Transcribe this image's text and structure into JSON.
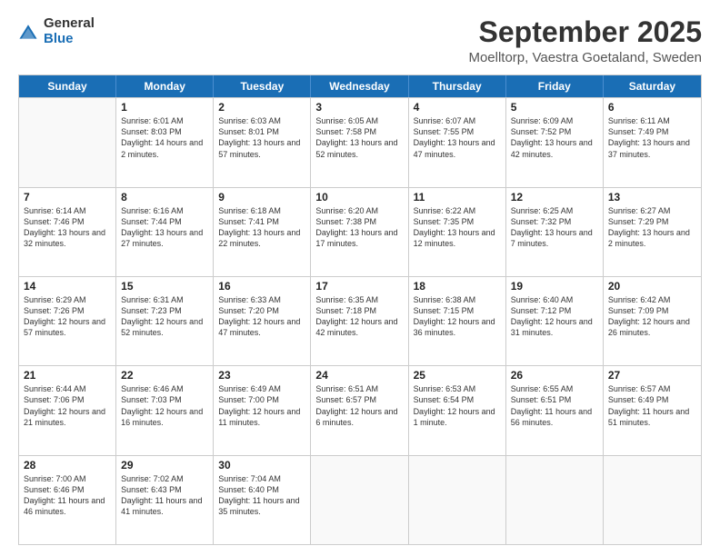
{
  "header": {
    "logo_general": "General",
    "logo_blue": "Blue",
    "month_title": "September 2025",
    "location": "Moelltorp, Vaestra Goetaland, Sweden"
  },
  "calendar": {
    "days_of_week": [
      "Sunday",
      "Monday",
      "Tuesday",
      "Wednesday",
      "Thursday",
      "Friday",
      "Saturday"
    ],
    "rows": [
      [
        {
          "day": "",
          "sunrise": "",
          "sunset": "",
          "daylight": ""
        },
        {
          "day": "1",
          "sunrise": "Sunrise: 6:01 AM",
          "sunset": "Sunset: 8:03 PM",
          "daylight": "Daylight: 14 hours and 2 minutes."
        },
        {
          "day": "2",
          "sunrise": "Sunrise: 6:03 AM",
          "sunset": "Sunset: 8:01 PM",
          "daylight": "Daylight: 13 hours and 57 minutes."
        },
        {
          "day": "3",
          "sunrise": "Sunrise: 6:05 AM",
          "sunset": "Sunset: 7:58 PM",
          "daylight": "Daylight: 13 hours and 52 minutes."
        },
        {
          "day": "4",
          "sunrise": "Sunrise: 6:07 AM",
          "sunset": "Sunset: 7:55 PM",
          "daylight": "Daylight: 13 hours and 47 minutes."
        },
        {
          "day": "5",
          "sunrise": "Sunrise: 6:09 AM",
          "sunset": "Sunset: 7:52 PM",
          "daylight": "Daylight: 13 hours and 42 minutes."
        },
        {
          "day": "6",
          "sunrise": "Sunrise: 6:11 AM",
          "sunset": "Sunset: 7:49 PM",
          "daylight": "Daylight: 13 hours and 37 minutes."
        }
      ],
      [
        {
          "day": "7",
          "sunrise": "Sunrise: 6:14 AM",
          "sunset": "Sunset: 7:46 PM",
          "daylight": "Daylight: 13 hours and 32 minutes."
        },
        {
          "day": "8",
          "sunrise": "Sunrise: 6:16 AM",
          "sunset": "Sunset: 7:44 PM",
          "daylight": "Daylight: 13 hours and 27 minutes."
        },
        {
          "day": "9",
          "sunrise": "Sunrise: 6:18 AM",
          "sunset": "Sunset: 7:41 PM",
          "daylight": "Daylight: 13 hours and 22 minutes."
        },
        {
          "day": "10",
          "sunrise": "Sunrise: 6:20 AM",
          "sunset": "Sunset: 7:38 PM",
          "daylight": "Daylight: 13 hours and 17 minutes."
        },
        {
          "day": "11",
          "sunrise": "Sunrise: 6:22 AM",
          "sunset": "Sunset: 7:35 PM",
          "daylight": "Daylight: 13 hours and 12 minutes."
        },
        {
          "day": "12",
          "sunrise": "Sunrise: 6:25 AM",
          "sunset": "Sunset: 7:32 PM",
          "daylight": "Daylight: 13 hours and 7 minutes."
        },
        {
          "day": "13",
          "sunrise": "Sunrise: 6:27 AM",
          "sunset": "Sunset: 7:29 PM",
          "daylight": "Daylight: 13 hours and 2 minutes."
        }
      ],
      [
        {
          "day": "14",
          "sunrise": "Sunrise: 6:29 AM",
          "sunset": "Sunset: 7:26 PM",
          "daylight": "Daylight: 12 hours and 57 minutes."
        },
        {
          "day": "15",
          "sunrise": "Sunrise: 6:31 AM",
          "sunset": "Sunset: 7:23 PM",
          "daylight": "Daylight: 12 hours and 52 minutes."
        },
        {
          "day": "16",
          "sunrise": "Sunrise: 6:33 AM",
          "sunset": "Sunset: 7:20 PM",
          "daylight": "Daylight: 12 hours and 47 minutes."
        },
        {
          "day": "17",
          "sunrise": "Sunrise: 6:35 AM",
          "sunset": "Sunset: 7:18 PM",
          "daylight": "Daylight: 12 hours and 42 minutes."
        },
        {
          "day": "18",
          "sunrise": "Sunrise: 6:38 AM",
          "sunset": "Sunset: 7:15 PM",
          "daylight": "Daylight: 12 hours and 36 minutes."
        },
        {
          "day": "19",
          "sunrise": "Sunrise: 6:40 AM",
          "sunset": "Sunset: 7:12 PM",
          "daylight": "Daylight: 12 hours and 31 minutes."
        },
        {
          "day": "20",
          "sunrise": "Sunrise: 6:42 AM",
          "sunset": "Sunset: 7:09 PM",
          "daylight": "Daylight: 12 hours and 26 minutes."
        }
      ],
      [
        {
          "day": "21",
          "sunrise": "Sunrise: 6:44 AM",
          "sunset": "Sunset: 7:06 PM",
          "daylight": "Daylight: 12 hours and 21 minutes."
        },
        {
          "day": "22",
          "sunrise": "Sunrise: 6:46 AM",
          "sunset": "Sunset: 7:03 PM",
          "daylight": "Daylight: 12 hours and 16 minutes."
        },
        {
          "day": "23",
          "sunrise": "Sunrise: 6:49 AM",
          "sunset": "Sunset: 7:00 PM",
          "daylight": "Daylight: 12 hours and 11 minutes."
        },
        {
          "day": "24",
          "sunrise": "Sunrise: 6:51 AM",
          "sunset": "Sunset: 6:57 PM",
          "daylight": "Daylight: 12 hours and 6 minutes."
        },
        {
          "day": "25",
          "sunrise": "Sunrise: 6:53 AM",
          "sunset": "Sunset: 6:54 PM",
          "daylight": "Daylight: 12 hours and 1 minute."
        },
        {
          "day": "26",
          "sunrise": "Sunrise: 6:55 AM",
          "sunset": "Sunset: 6:51 PM",
          "daylight": "Daylight: 11 hours and 56 minutes."
        },
        {
          "day": "27",
          "sunrise": "Sunrise: 6:57 AM",
          "sunset": "Sunset: 6:49 PM",
          "daylight": "Daylight: 11 hours and 51 minutes."
        }
      ],
      [
        {
          "day": "28",
          "sunrise": "Sunrise: 7:00 AM",
          "sunset": "Sunset: 6:46 PM",
          "daylight": "Daylight: 11 hours and 46 minutes."
        },
        {
          "day": "29",
          "sunrise": "Sunrise: 7:02 AM",
          "sunset": "Sunset: 6:43 PM",
          "daylight": "Daylight: 11 hours and 41 minutes."
        },
        {
          "day": "30",
          "sunrise": "Sunrise: 7:04 AM",
          "sunset": "Sunset: 6:40 PM",
          "daylight": "Daylight: 11 hours and 35 minutes."
        },
        {
          "day": "",
          "sunrise": "",
          "sunset": "",
          "daylight": ""
        },
        {
          "day": "",
          "sunrise": "",
          "sunset": "",
          "daylight": ""
        },
        {
          "day": "",
          "sunrise": "",
          "sunset": "",
          "daylight": ""
        },
        {
          "day": "",
          "sunrise": "",
          "sunset": "",
          "daylight": ""
        }
      ]
    ]
  }
}
